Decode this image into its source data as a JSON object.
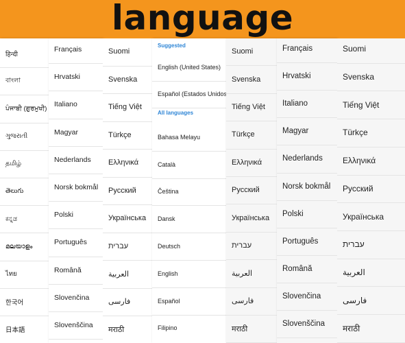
{
  "banner": {
    "title": "language"
  },
  "columns": [
    {
      "items": [
        "हिन्दी",
        "বাংলা",
        "ਪੰਜਾਬੀ (ਗੁਰਮੁਖੀ)",
        "ગુજરાતી",
        "தமிழ்",
        "తెలుగు",
        "ಕನ್ನಡ",
        "മലയാളം",
        "ไทย",
        "한국어",
        "日本語"
      ]
    },
    {
      "items": [
        "Français",
        "Hrvatski",
        "Italiano",
        "Magyar",
        "Nederlands",
        "Norsk bokmål",
        "Polski",
        "Português",
        "Română",
        "Slovenčina",
        "Slovenščina"
      ]
    },
    {
      "items": [
        "Suomi",
        "Svenska",
        "Tiếng Việt",
        "Türkçe",
        "Ελληνικά",
        "Русский",
        "Українська",
        "עברית",
        "العربية",
        "فارسی",
        "मराठी"
      ]
    },
    {
      "suggested_label": "Suggested",
      "suggested": [
        "English (United States)",
        "Español (Estados Unidos)"
      ],
      "all_label": "All languages",
      "all": [
        "Bahasa Melayu",
        "Català",
        "Čeština",
        "Dansk",
        "Deutsch",
        "English",
        "Español",
        "Filipino"
      ]
    },
    {
      "items": [
        "Suomi",
        "Svenska",
        "Tiếng Việt",
        "Türkçe",
        "Ελληνικά",
        "Русский",
        "Українська",
        "עברית",
        "العربية",
        "فارسی",
        "मराठी"
      ]
    },
    {
      "items": [
        "Français",
        "Hrvatski",
        "Italiano",
        "Magyar",
        "Nederlands",
        "Norsk bokmål",
        "Polski",
        "Português",
        "Română",
        "Slovenčina",
        "Slovenščina"
      ]
    },
    {
      "items": [
        "Suomi",
        "Svenska",
        "Tiếng Việt",
        "Türkçe",
        "Ελληνικά",
        "Русский",
        "Українська",
        "עברית",
        "العربية",
        "فارسی",
        "मराठी"
      ]
    }
  ]
}
